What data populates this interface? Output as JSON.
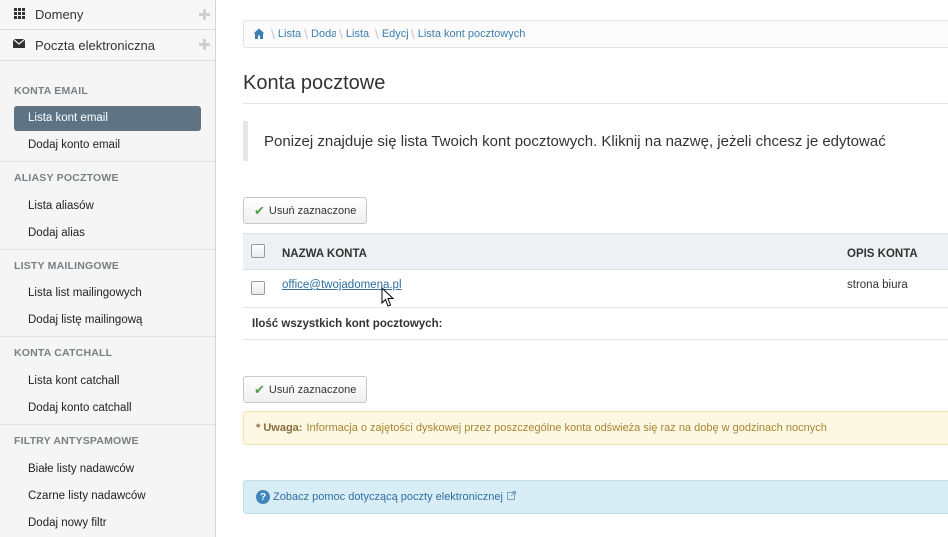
{
  "sidebar": {
    "top_items": [
      {
        "label": "Domeny",
        "icon": "grid-icon"
      },
      {
        "label": "Poczta elektroniczna",
        "icon": "envelope-icon"
      }
    ],
    "sections": [
      {
        "title": "KONTA EMAIL",
        "items": [
          "Lista kont email",
          "Dodaj konto email"
        ]
      },
      {
        "title": "ALIASY POCZTOWE",
        "items": [
          "Lista aliasów",
          "Dodaj alias"
        ]
      },
      {
        "title": "LISTY MAILINGOWE",
        "items": [
          "Lista list mailingowych",
          "Dodaj listę mailingową"
        ]
      },
      {
        "title": "KONTA CATCHALL",
        "items": [
          "Lista kont catchall",
          "Dodaj konto catchall"
        ]
      },
      {
        "title": "FILTRY ANTYSPAMOWE",
        "items": [
          "Białe listy nadawców",
          "Czarne listy nadawców",
          "Dodaj nowy filtr"
        ]
      }
    ],
    "active_item": "Lista kont email"
  },
  "breadcrumb": {
    "items": [
      "Lista",
      "Doda",
      "Lista l",
      "Edycj",
      "Lista kont pocztowych"
    ]
  },
  "main": {
    "title": "Konta pocztowe",
    "info": "Ponizej znajduje się lista Twoich kont pocztowych. Kliknij na nazwę, jeżeli chcesz je edytować",
    "delete_button": "Usuń zaznaczone",
    "table": {
      "col_name": "NAZWA KONTA",
      "col_desc": "OPIS KONTA",
      "rows": [
        {
          "name": "office@twojadomena.pl",
          "desc": "strona biura"
        }
      ],
      "footer": "Ilość wszystkich kont pocztowych:"
    },
    "warning_label": "* Uwaga:",
    "warning_text": "Informacja o zajętości dyskowej przez poszczególne konta odświeża się raz na dobę w godzinach nocnych",
    "help_text": "Zobacz pomoc dotyczącą poczty elektronicznej"
  },
  "colors": {
    "active_bg": "#5e7485",
    "link": "#2f6ea0",
    "check": "#4ea046",
    "warning_bg": "#fcf8e3",
    "help_bg": "#d9edf7"
  }
}
